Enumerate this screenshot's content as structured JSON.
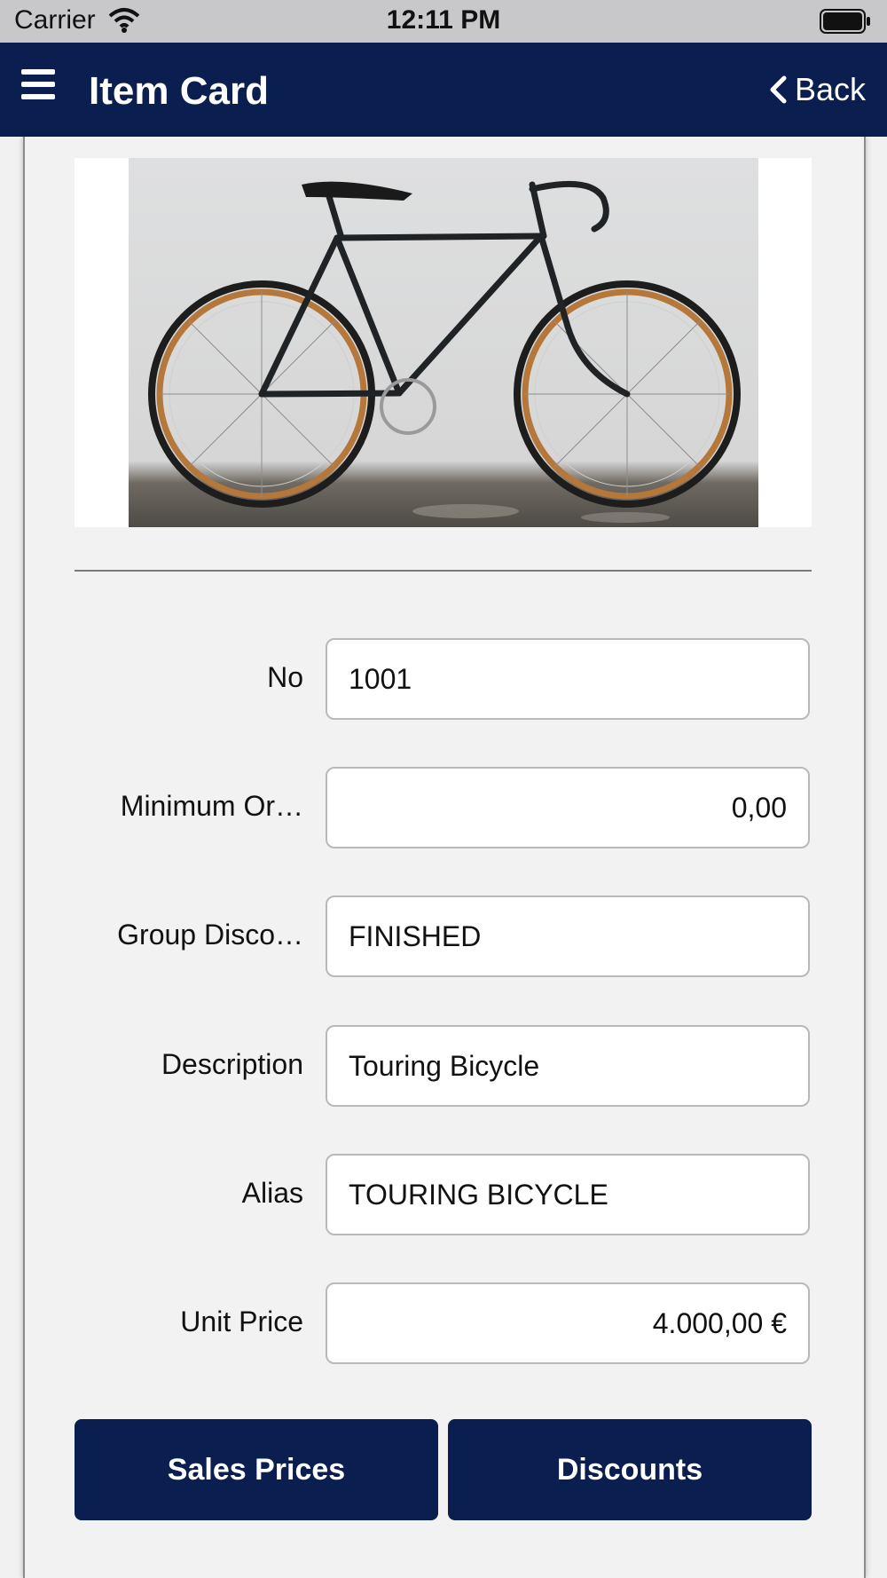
{
  "status_bar": {
    "carrier": "Carrier",
    "time": "12:11 PM"
  },
  "nav": {
    "title": "Item Card",
    "back_label": "Back"
  },
  "image": {
    "alt": "bicycle-photo"
  },
  "fields": [
    {
      "label": "No",
      "value": "1001",
      "align": "left"
    },
    {
      "label": "Minimum Or…",
      "value": "0,00",
      "align": "right"
    },
    {
      "label": "Group Disco…",
      "value": "FINISHED",
      "align": "left"
    },
    {
      "label": "Description",
      "value": "Touring Bicycle",
      "align": "left"
    },
    {
      "label": "Alias",
      "value": "TOURING BICYCLE",
      "align": "left"
    },
    {
      "label": "Unit Price",
      "value": "4.000,00 €",
      "align": "right"
    }
  ],
  "buttons": {
    "sales_prices": "Sales Prices",
    "discounts": "Discounts"
  },
  "colors": {
    "nav_bg": "#0a1f4f",
    "status_bg": "#c8c8cb",
    "page_bg": "#f1f1f1"
  }
}
